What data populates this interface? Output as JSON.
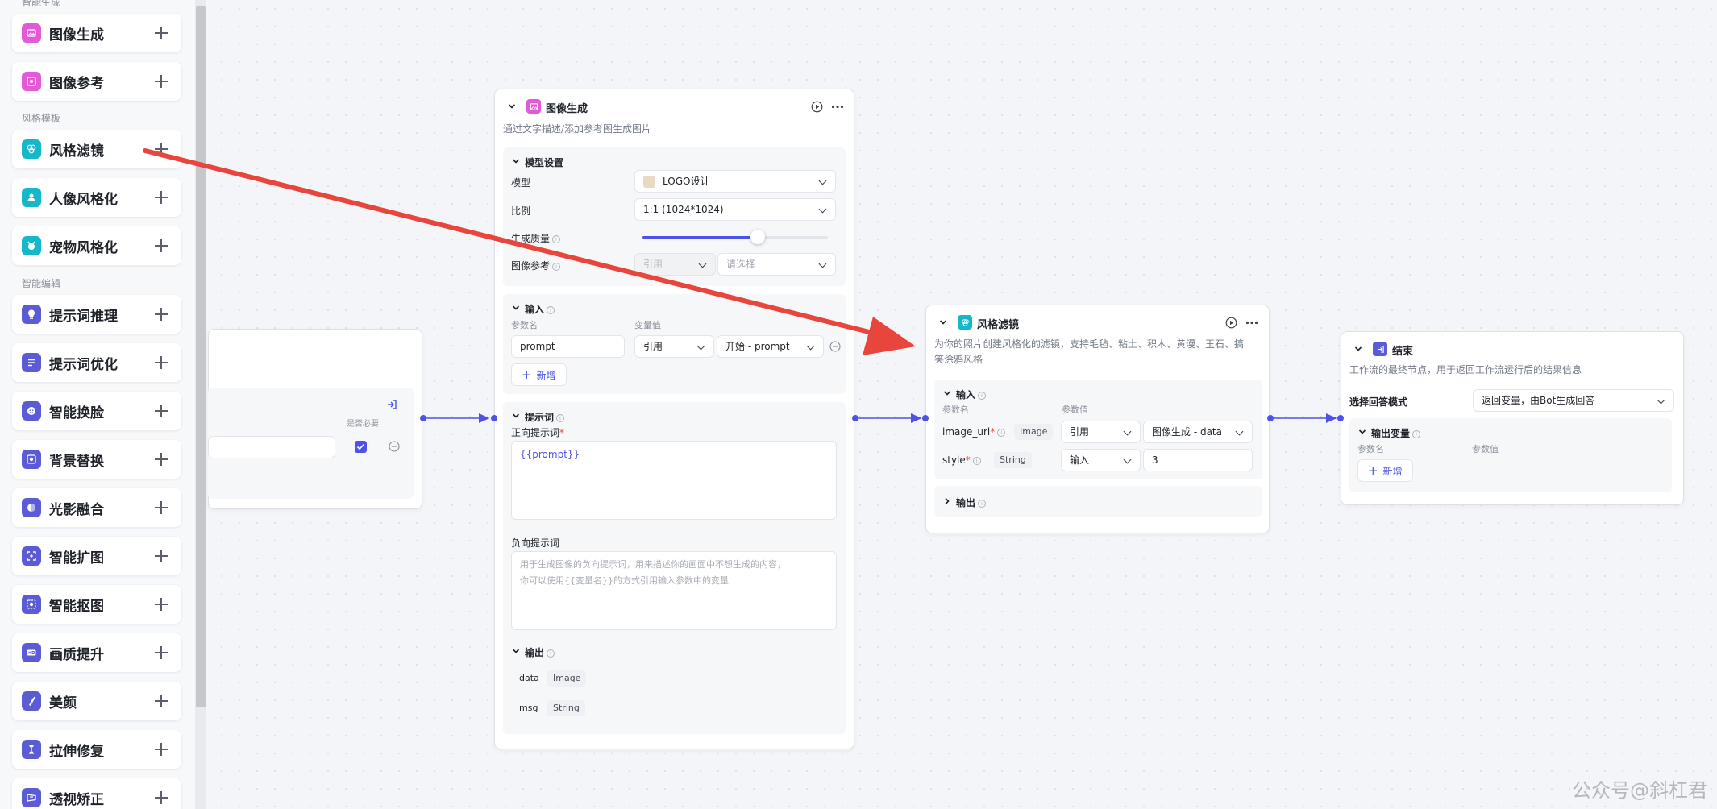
{
  "sidebar": {
    "group_top": "智能生成",
    "group_style": "风格模板",
    "group_edit": "智能编辑",
    "items": [
      {
        "label": "图像生成",
        "icon": "image-icon",
        "color": "#e35ad6"
      },
      {
        "label": "图像参考",
        "icon": "image-reference-icon",
        "color": "#e35ad6"
      },
      {
        "label": "风格滤镜",
        "icon": "filter-icon",
        "color": "#14b8c9"
      },
      {
        "label": "人像风格化",
        "icon": "portrait-icon",
        "color": "#14b8c9"
      },
      {
        "label": "宠物风格化",
        "icon": "pet-icon",
        "color": "#14b8c9"
      },
      {
        "label": "提示词推理",
        "icon": "lightbulb-icon",
        "color": "#5b5bd6"
      },
      {
        "label": "提示词优化",
        "icon": "list-icon",
        "color": "#5b5bd6"
      },
      {
        "label": "智能换脸",
        "icon": "face-icon",
        "color": "#5b5bd6"
      },
      {
        "label": "背景替换",
        "icon": "background-icon",
        "color": "#5b5bd6"
      },
      {
        "label": "光影融合",
        "icon": "light-icon",
        "color": "#5b5bd6"
      },
      {
        "label": "智能扩图",
        "icon": "expand-icon",
        "color": "#5b5bd6"
      },
      {
        "label": "智能抠图",
        "icon": "cutout-icon",
        "color": "#5b5bd6"
      },
      {
        "label": "画质提升",
        "icon": "hd-icon",
        "color": "#5b5bd6"
      },
      {
        "label": "美颜",
        "icon": "beauty-icon",
        "color": "#5b5bd6"
      },
      {
        "label": "拉伸修复",
        "icon": "stretch-icon",
        "color": "#5b5bd6"
      },
      {
        "label": "透视矫正",
        "icon": "perspective-icon",
        "color": "#5b5bd6"
      }
    ]
  },
  "start_node": {
    "required_header": "是否必要"
  },
  "image_gen_node": {
    "title": "图像生成",
    "desc": "通过文字描述/添加参考图生成图片",
    "model_section": "模型设置",
    "model_label": "模型",
    "model_value": "LOGO设计",
    "ratio_label": "比例",
    "ratio_value": "1:1 (1024*1024)",
    "quality_label": "生成质量",
    "quality_level": 0.62,
    "ref_label": "图像参考",
    "ref_mode": "引用",
    "ref_placeholder": "请选择",
    "input_section": "输入",
    "param_name_header": "参数名",
    "var_value_header": "变量值",
    "param_name": "prompt",
    "param_mode": "引用",
    "param_ref": "开始 - prompt",
    "add_label": "新增",
    "prompt_section": "提示词",
    "positive_label": "正向提示词",
    "positive_value": "{{prompt}}",
    "negative_label": "负向提示词",
    "negative_placeholder_1": "用于生成图像的负向提示词，用来描述你的画面中不想生成的内容，",
    "negative_placeholder_2": "你可以使用{{变量名}}的方式引用输入参数中的变量",
    "output_section": "输出",
    "outputs": [
      {
        "name": "data",
        "type": "Image"
      },
      {
        "name": "msg",
        "type": "String"
      }
    ]
  },
  "filter_node": {
    "title": "风格滤镜",
    "desc_1": "为你的照片创建风格化的滤镜，支持毛毡、粘土、积木、黄漫、玉石、搞",
    "desc_2": "笑涂鸦风格",
    "input_section": "输入",
    "param_name_header": "参数名",
    "param_value_header": "参数值",
    "params": [
      {
        "name": "image_url",
        "type": "Image",
        "mode": "引用",
        "value": "图像生成 - data"
      },
      {
        "name": "style",
        "type": "String",
        "mode": "输入",
        "value": "3"
      }
    ],
    "output_section": "输出"
  },
  "end_node": {
    "title": "结束",
    "desc": "工作流的最终节点，用于返回工作流运行后的结果信息",
    "mode_label": "选择回答模式",
    "mode_value": "返回变量，由Bot生成回答",
    "output_section": "输出变量",
    "param_name_header": "参数名",
    "param_value_header": "参数值",
    "add_label": "新增"
  },
  "watermark": "公众号@斜杠君",
  "colors": {
    "accent": "#4d53e8",
    "arrow": "#e8463c"
  }
}
